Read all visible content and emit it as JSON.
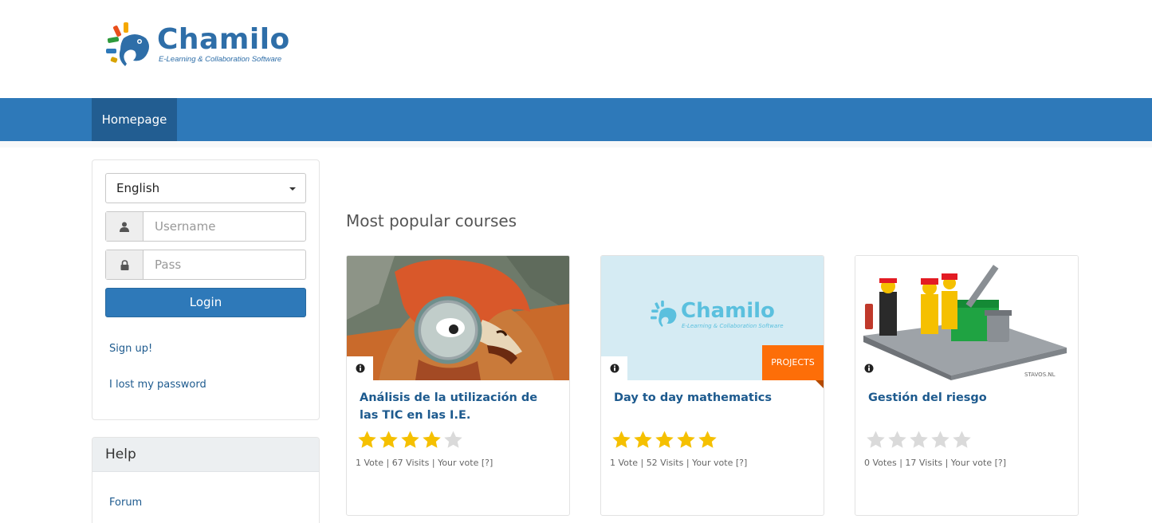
{
  "logo": {
    "name": "Chamilo",
    "tagline": "E-Learning & Collaboration Software"
  },
  "nav": {
    "items": [
      {
        "label": "Homepage"
      }
    ]
  },
  "login": {
    "language": "English",
    "username_placeholder": "Username",
    "password_placeholder": "Pass",
    "login_label": "Login",
    "signup_label": "Sign up!",
    "lost_password_label": "I lost my password"
  },
  "help": {
    "title": "Help",
    "links": [
      {
        "label": "Forum"
      }
    ]
  },
  "main": {
    "section_title": "Most popular courses",
    "courses": [
      {
        "title": "Análisis de la utilización de las TIC en las I.E.",
        "rating": 4,
        "meta": {
          "votes": "1 Vote",
          "visits": "67 Visits",
          "your_vote": "Your vote [?]"
        },
        "image": "cartoon-detective-fox-magnifier",
        "tag": ""
      },
      {
        "title": "Day to day mathematics",
        "rating": 5,
        "meta": {
          "votes": "1 Vote",
          "visits": "52 Visits",
          "your_vote": "Your vote [?]"
        },
        "image": "chamilo-logo-placeholder",
        "tag": "PROJECTS",
        "image_logo": {
          "name": "Chamilo",
          "tagline": "E-Learning & Collaboration Software"
        }
      },
      {
        "title": "Gestión del riesgo",
        "rating": 0,
        "meta": {
          "votes": "0 Votes",
          "visits": "17 Visits",
          "your_vote": "Your vote [?]"
        },
        "image": "lego-firefighters",
        "tag": "",
        "image_credit": "STAVOS.NL"
      }
    ]
  },
  "colors": {
    "primary": "#2e79b9",
    "nav_active": "#225d91",
    "link": "#1d5a8e",
    "star_on": "#f5c000",
    "star_off": "#dadada",
    "tag": "#fd6e08"
  },
  "icons": [
    "chameleon-logo-icon",
    "user-icon",
    "lock-icon",
    "caret-down-icon",
    "info-icon",
    "star-icon"
  ]
}
